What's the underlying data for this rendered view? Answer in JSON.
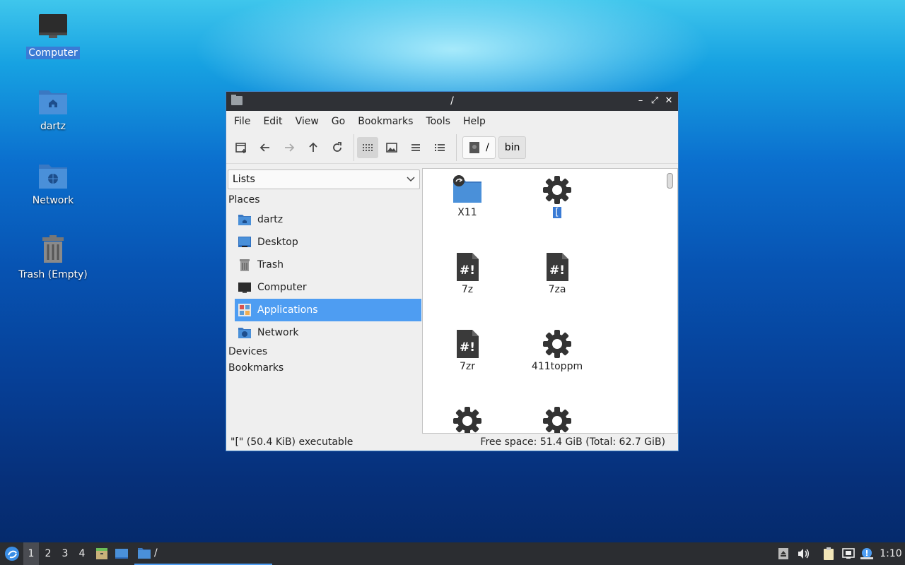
{
  "desktop": {
    "icons": [
      {
        "label": "Computer",
        "selected": true
      },
      {
        "label": "dartz"
      },
      {
        "label": "Network"
      },
      {
        "label": "Trash (Empty)"
      }
    ]
  },
  "window": {
    "title": "/",
    "buttons": {
      "minimize": "–",
      "maximize": "⤢",
      "close": "✕"
    },
    "menu": [
      "File",
      "Edit",
      "View",
      "Go",
      "Bookmarks",
      "Tools",
      "Help"
    ],
    "path": {
      "root": "/",
      "child": "bin"
    },
    "side": {
      "combo_value": "Lists",
      "places_header": "Places",
      "places": [
        {
          "label": "dartz",
          "icon": "home-folder-icon"
        },
        {
          "label": "Desktop",
          "icon": "desktop-icon"
        },
        {
          "label": "Trash",
          "icon": "trash-icon"
        },
        {
          "label": "Computer",
          "icon": "computer-icon"
        },
        {
          "label": "Applications",
          "icon": "applications-icon",
          "selected": true
        },
        {
          "label": "Network",
          "icon": "network-folder-icon"
        }
      ],
      "devices_header": "Devices",
      "bookmarks_header": "Bookmarks"
    },
    "files": [
      {
        "name": "X11",
        "icon": "folder-link-icon"
      },
      {
        "name": "[",
        "icon": "executable-gear-icon",
        "selected": true
      },
      {
        "name": "7z",
        "icon": "script-icon"
      },
      {
        "name": "7za",
        "icon": "script-icon"
      },
      {
        "name": "7zr",
        "icon": "script-icon"
      },
      {
        "name": "411toppm",
        "icon": "executable-gear-icon"
      },
      {
        "name": "",
        "icon": "executable-gear-icon"
      },
      {
        "name": "",
        "icon": "executable-gear-icon"
      }
    ],
    "status": {
      "left": "\"[\" (50.4 KiB) executable",
      "right": "Free space: 51.4 GiB (Total: 62.7 GiB)"
    }
  },
  "taskbar": {
    "workspaces": [
      "1",
      "2",
      "3",
      "4"
    ],
    "current_workspace": "1",
    "task_label": "/",
    "clock": "1:10"
  },
  "colors": {
    "accent": "#4e9df2",
    "folder": "#4a90d9",
    "titlebar": "#2f3136"
  }
}
